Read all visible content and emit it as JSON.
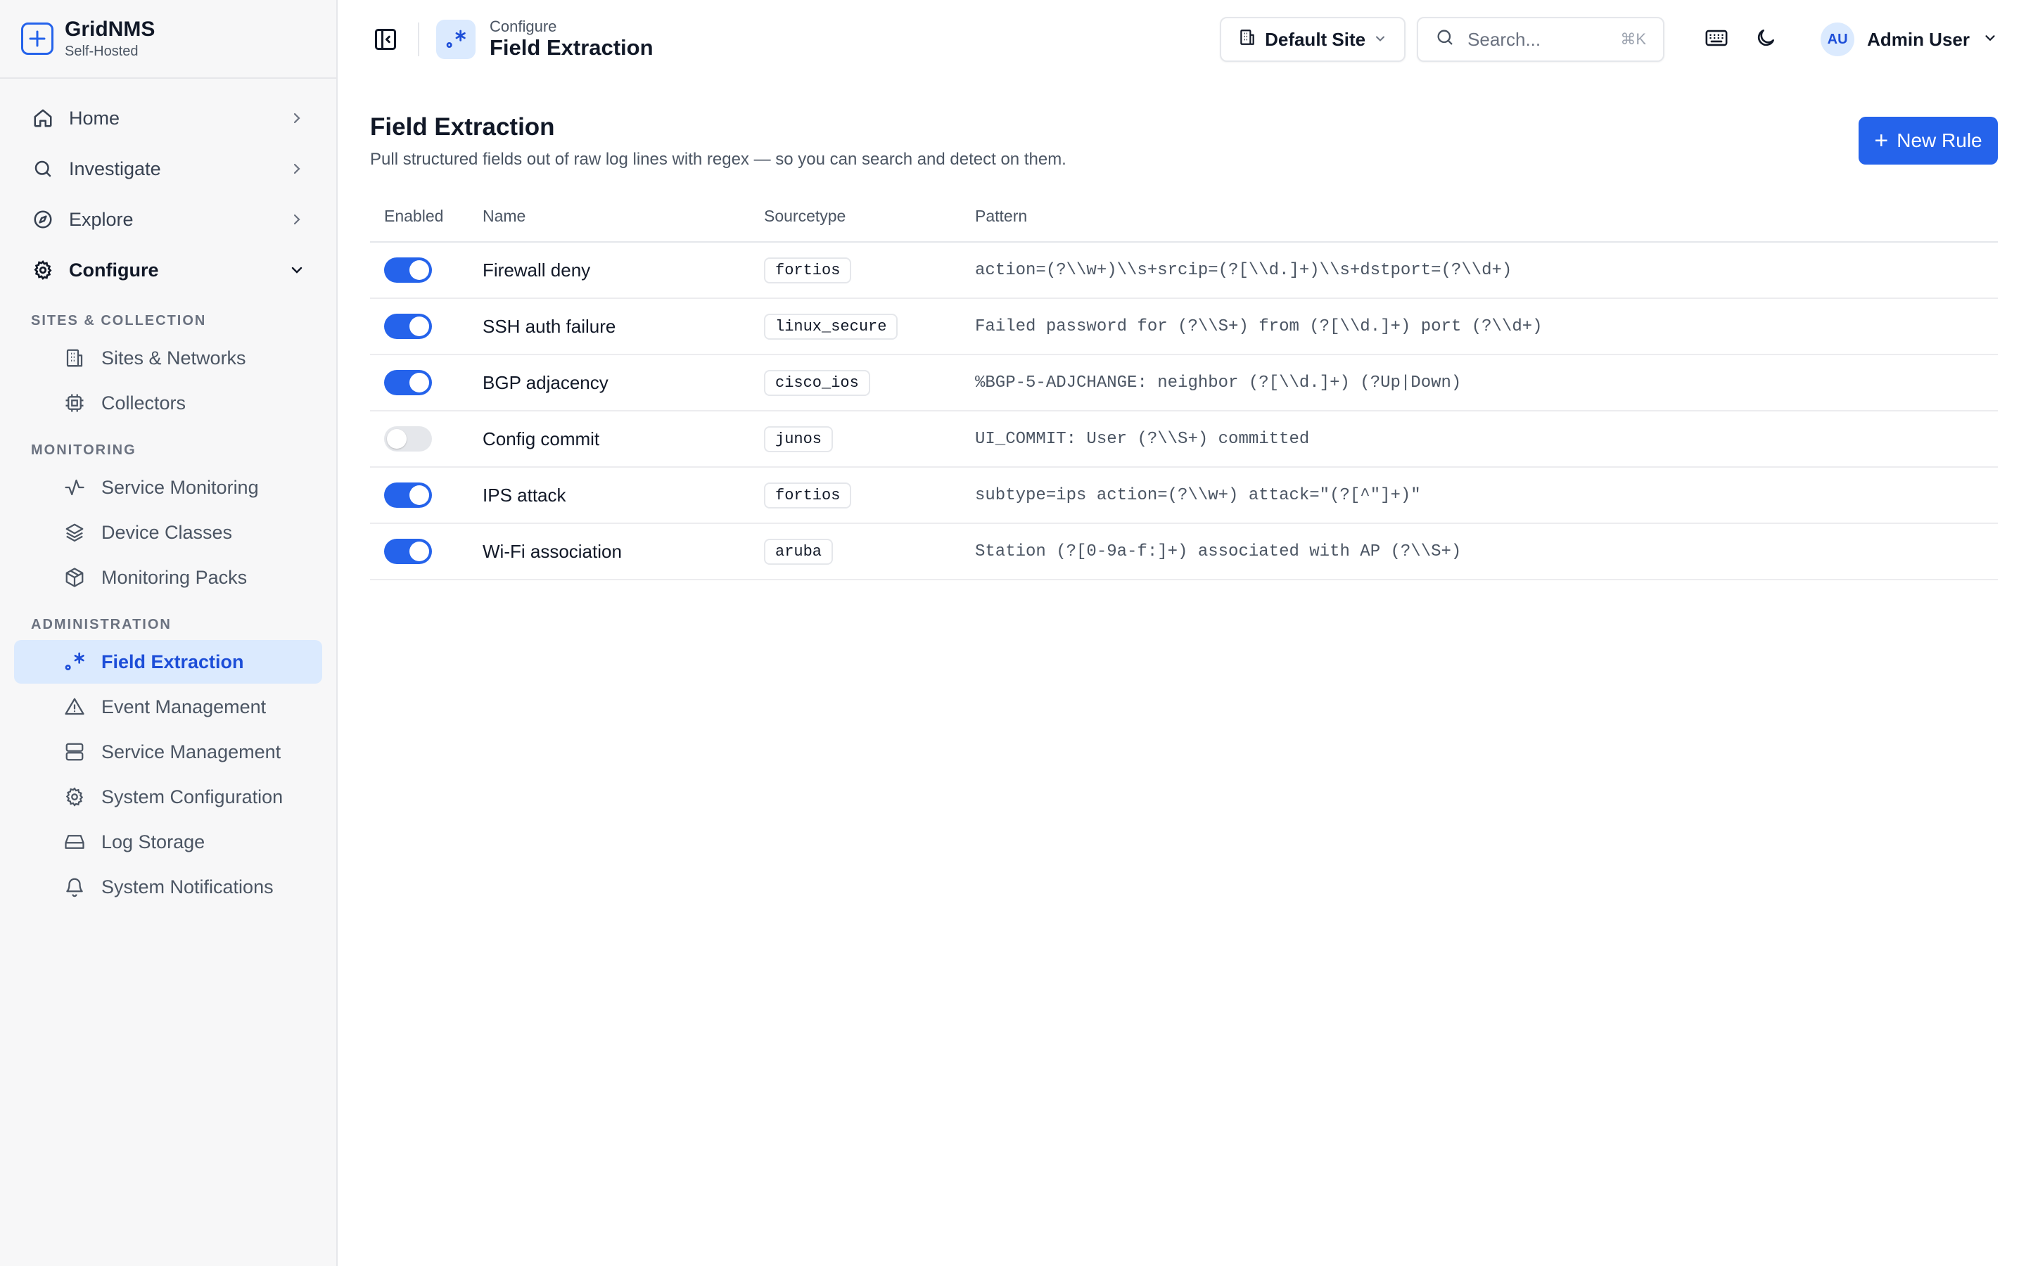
{
  "brand": {
    "name": "GridNMS",
    "subtitle": "Self-Hosted"
  },
  "sidebar": {
    "top_items": [
      {
        "label": "Home",
        "icon": "home-icon"
      },
      {
        "label": "Investigate",
        "icon": "search-icon"
      },
      {
        "label": "Explore",
        "icon": "compass-icon"
      },
      {
        "label": "Configure",
        "icon": "gear-icon"
      }
    ],
    "sections": [
      {
        "title": "SITES & COLLECTION",
        "items": [
          {
            "label": "Sites & Networks",
            "icon": "building-icon"
          },
          {
            "label": "Collectors",
            "icon": "chip-icon"
          }
        ]
      },
      {
        "title": "MONITORING",
        "items": [
          {
            "label": "Service Monitoring",
            "icon": "activity-icon"
          },
          {
            "label": "Device Classes",
            "icon": "layers-icon"
          },
          {
            "label": "Monitoring Packs",
            "icon": "package-icon"
          }
        ]
      },
      {
        "title": "ADMINISTRATION",
        "items": [
          {
            "label": "Field Extraction",
            "icon": "regex-icon"
          },
          {
            "label": "Event Management",
            "icon": "warning-icon"
          },
          {
            "label": "Service Management",
            "icon": "server-icon"
          },
          {
            "label": "System Configuration",
            "icon": "gear-icon"
          },
          {
            "label": "Log Storage",
            "icon": "hard-drive-icon"
          },
          {
            "label": "System Notifications",
            "icon": "bell-icon"
          }
        ]
      }
    ]
  },
  "header": {
    "breadcrumb_parent": "Configure",
    "breadcrumb_current": "Field Extraction",
    "site_selector": "Default Site",
    "search_placeholder": "Search...",
    "search_shortcut": "⌘K",
    "user_initials": "AU",
    "user_name": "Admin User"
  },
  "page": {
    "title": "Field Extraction",
    "description": "Pull structured fields out of raw log lines with regex — so you can search and detect on them.",
    "new_button": "New Rule",
    "columns": [
      "Enabled",
      "Name",
      "Sourcetype",
      "Pattern"
    ],
    "rules": [
      {
        "enabled": true,
        "name": "Firewall deny",
        "sourcetype": "fortios",
        "pattern": "action=(?\\\\w+)\\\\s+srcip=(?[\\\\d.]+)\\\\s+dstport=(?\\\\d+)"
      },
      {
        "enabled": true,
        "name": "SSH auth failure",
        "sourcetype": "linux_secure",
        "pattern": "Failed password for (?\\\\S+) from (?[\\\\d.]+) port (?\\\\d+)"
      },
      {
        "enabled": true,
        "name": "BGP adjacency",
        "sourcetype": "cisco_ios",
        "pattern": "%BGP-5-ADJCHANGE: neighbor (?[\\\\d.]+) (?Up|Down)"
      },
      {
        "enabled": false,
        "name": "Config commit",
        "sourcetype": "junos",
        "pattern": "UI_COMMIT: User (?\\\\S+) committed"
      },
      {
        "enabled": true,
        "name": "IPS attack",
        "sourcetype": "fortios",
        "pattern": "subtype=ips action=(?\\\\w+) attack=\"(?[^\"]+)\""
      },
      {
        "enabled": true,
        "name": "Wi-Fi association",
        "sourcetype": "aruba",
        "pattern": "Station (?[0-9a-f:]+) associated with AP (?\\\\S+)"
      }
    ]
  },
  "colors": {
    "accent": "#2563eb",
    "active_bg": "#dbeafe",
    "sidebar_bg": "#f7f7f8"
  }
}
